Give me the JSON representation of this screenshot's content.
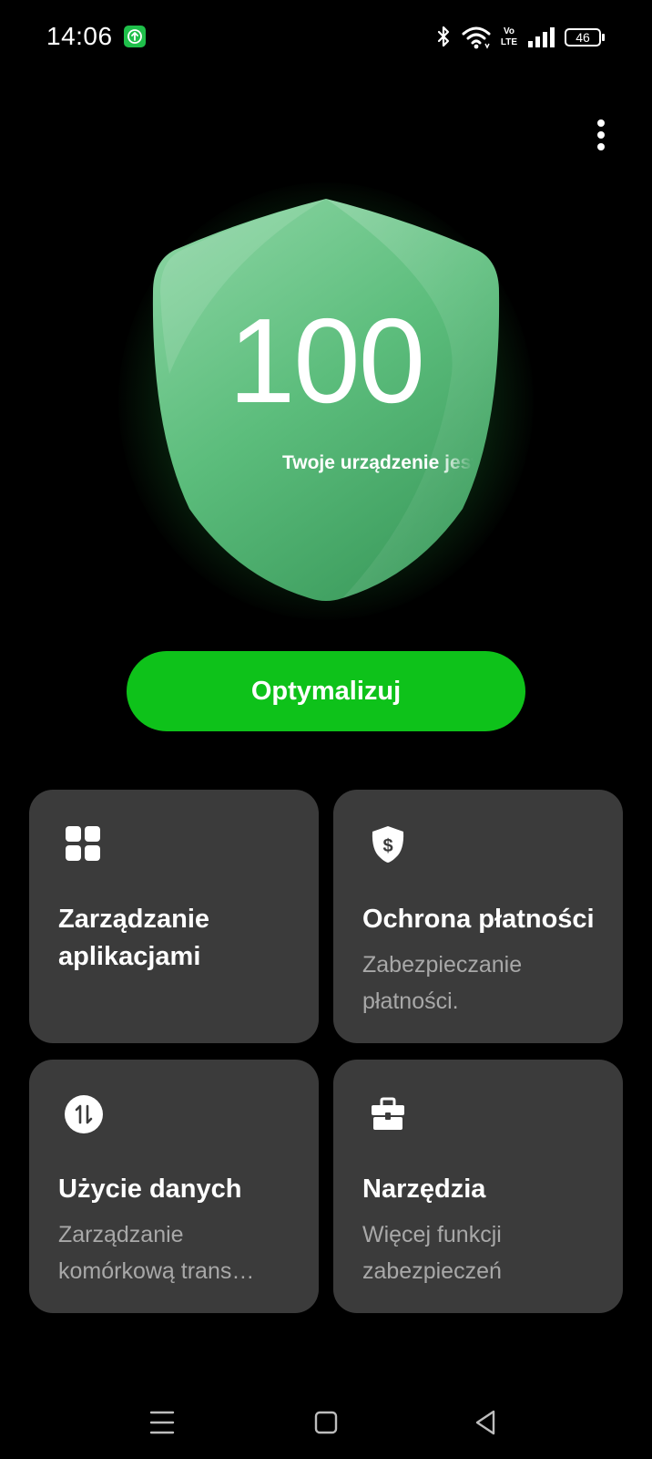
{
  "status_bar": {
    "time": "14:06",
    "notification_icon": "upload-arrow-icon",
    "icons": [
      "bluetooth-icon",
      "wifi-icon",
      "volte-icon",
      "signal-icon"
    ],
    "volte_label_top": "Vo",
    "volte_label_bottom": "LTE",
    "battery_level": "46"
  },
  "header": {
    "menu_icon": "more-vertical-icon"
  },
  "score": {
    "value": "100",
    "status_text": "Twoje urządzenie jest bezpieczne",
    "shield_color": "#5fbf80"
  },
  "optimize_button": {
    "label": "Optymalizuj",
    "color": "#0ec21a"
  },
  "cards": [
    {
      "icon": "grid-apps-icon",
      "title": "Zarządzanie aplikacjami",
      "description": ""
    },
    {
      "icon": "dollar-shield-icon",
      "title": "Ochrona płatności",
      "description": "Zabezpieczanie płatności."
    },
    {
      "icon": "data-transfer-icon",
      "title": "Użycie danych",
      "description": "Zarządzanie komórkową trans…"
    },
    {
      "icon": "toolbox-icon",
      "title": "Narzędzia",
      "description": "Więcej funkcji zabezpieczeń"
    }
  ],
  "nav_bar": {
    "items": [
      "menu-lines-icon",
      "home-square-icon",
      "back-triangle-icon"
    ]
  }
}
